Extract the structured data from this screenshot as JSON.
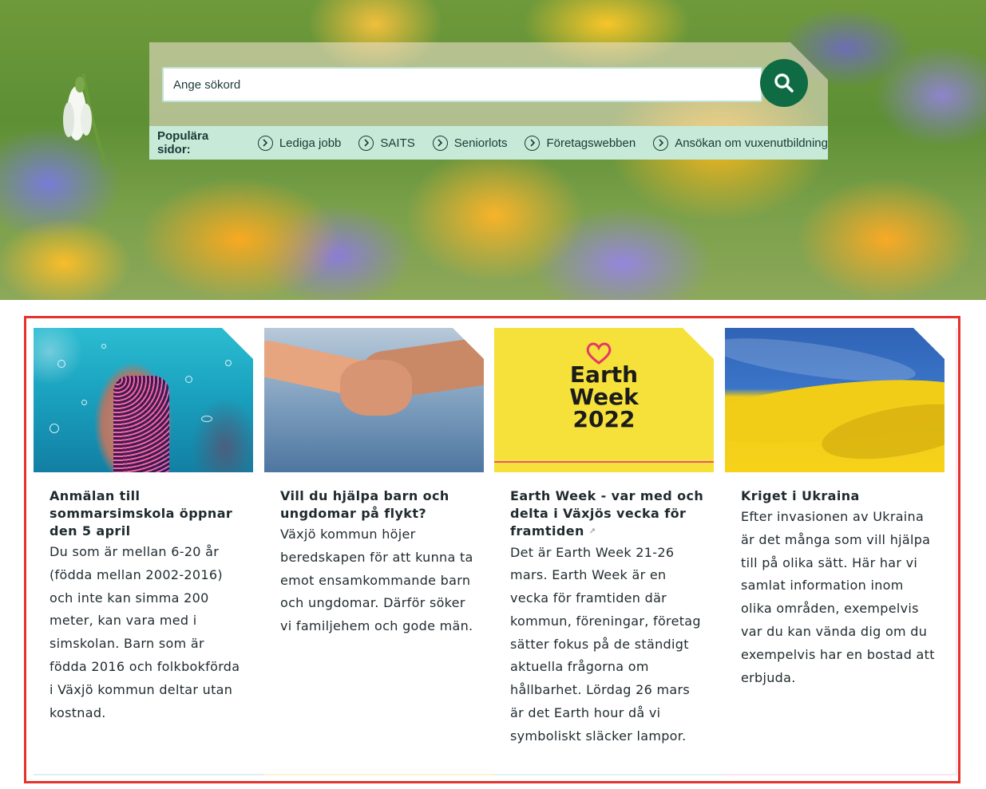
{
  "search": {
    "placeholder": "Ange sökord",
    "button_label": "Sök"
  },
  "popular": {
    "label": "Populära sidor:",
    "links": [
      "Lediga jobb",
      "SAITS",
      "Seniorlots",
      "Företagswebben",
      "Ansökan om vuxenutbildning"
    ]
  },
  "cards": [
    {
      "title": "Anmälan till sommarsimskola öppnar den 5 april",
      "body": "Du som är mellan 6-20 år (födda mellan 2002-2016) och inte kan simma 200 meter, kan vara med i simskolan. Barn som är födda 2016 och folkbokförda i Växjö kommun deltar utan kostnad.",
      "accent": "#9fd3e6"
    },
    {
      "title": "Vill du hjälpa barn och ungdomar på flykt?",
      "body": "Växjö kommun höjer beredskapen för att kunna ta emot ensamkommande barn och ungdomar. Därför söker vi familjehem och gode män.",
      "accent": "#f4e27a"
    },
    {
      "title": "Earth Week - var med och delta i Växjös vecka för framtiden",
      "body": "Det är Earth Week 21-26 mars. Earth Week är en vecka för framtiden där kommun, föreningar, företag sätter fokus på de ständigt aktuella frågorna om hållbarhet. Lördag 26 mars är det Earth hour då vi symboliskt släcker lampor.",
      "accent": "#a8ddd0",
      "image_text": [
        "Earth",
        "Week",
        "2022"
      ]
    },
    {
      "title": "Kriget i Ukraina",
      "body": "Efter invasionen av Ukraina är det många som vill hjälpa till på olika sätt. Här har vi samlat information inom olika områden, exempelvis var du kan vända dig om du exempelvis har en bostad att erbjuda.",
      "accent": "#f1b7d6"
    }
  ],
  "colors": {
    "search_button": "#0f6b43",
    "popular_bar": "#c7ead8",
    "highlight": "#e5322d"
  }
}
